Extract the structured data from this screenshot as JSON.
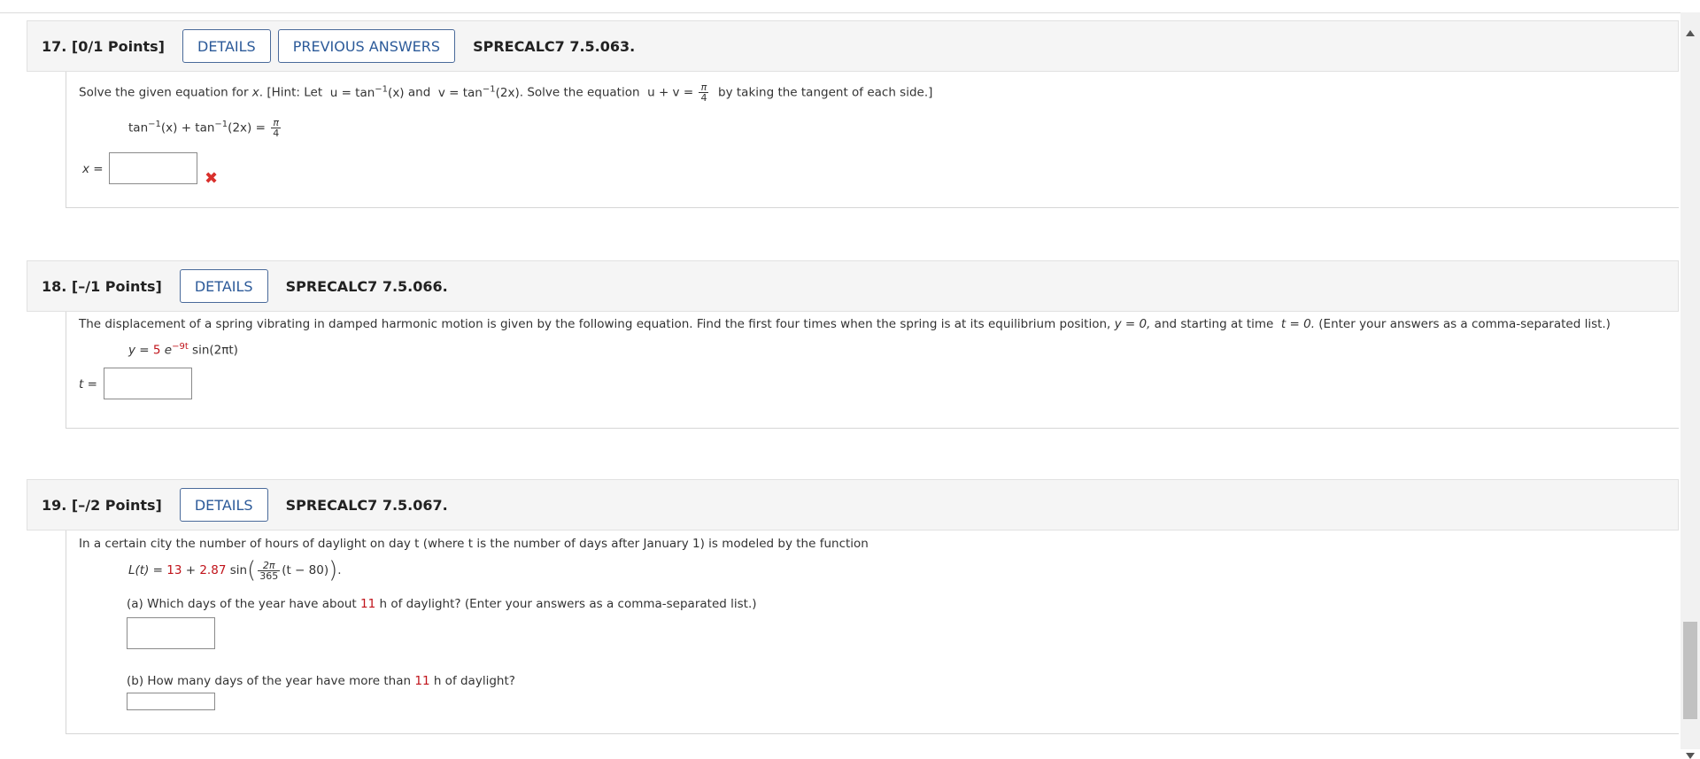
{
  "questions": [
    {
      "number": "17.",
      "points": "[0/1 Points]",
      "details_label": "DETAILS",
      "prev_label": "PREVIOUS ANSWERS",
      "code": "SPRECALC7 7.5.063.",
      "prompt_start": "Solve the given equation for ",
      "prompt_var": "x",
      "prompt_hint": ". [Hint: Let ",
      "hint_u": "u = tan",
      "hint_u_arg": "(x)",
      "hint_and": " and ",
      "hint_v": "v = tan",
      "hint_v_arg": "(2x)",
      "hint_solve": ". Solve the equation ",
      "hint_uv": "u + v = ",
      "hint_end": " by taking the tangent of each side.]",
      "equation_a": "tan",
      "equation_a_arg": "(x) + tan",
      "equation_b_arg": "(2x) = ",
      "pi": "π",
      "four": "4",
      "answer_label": "x =",
      "status_icon": "x-mark-icon"
    },
    {
      "number": "18.",
      "points": "[–/1 Points]",
      "details_label": "DETAILS",
      "code": "SPRECALC7 7.5.066.",
      "prompt": "The displacement of a spring vibrating in damped harmonic motion is given by the following equation. Find the first four times when the spring is at its equilibrium position, ",
      "prompt_eq": "y = 0,",
      "prompt_mid": " and starting at time ",
      "prompt_t": "t = 0.",
      "prompt_end": " (Enter your answers as a comma-separated list.)",
      "equation_lhs": "y = ",
      "equation_coef": "5",
      "equation_e": " e",
      "equation_exp": "−9t",
      "equation_rest": " sin(2πt)",
      "answer_label": "t ="
    },
    {
      "number": "19.",
      "points": "[–/2 Points]",
      "details_label": "DETAILS",
      "code": "SPRECALC7 7.5.067.",
      "prompt": "In a certain city the number of hours of daylight on day t (where t is the number of days after January 1) is modeled by the function",
      "eq_lhs": "L(t) = ",
      "eq_a": "13",
      "eq_plus": " + ",
      "eq_b": "2.87",
      "eq_sin": " sin",
      "eq_num": "2π",
      "eq_den": "365",
      "eq_tail": "(t − 80)",
      "eq_end": ".",
      "part_a_start": "(a) Which days of the year have about ",
      "part_a_num": "11",
      "part_a_end": " h of daylight? (Enter your answers as a comma-separated list.)",
      "part_b_start": "(b) How many days of the year have more than ",
      "part_b_num": "11",
      "part_b_end": " h of daylight?"
    }
  ],
  "colors": {
    "accent_button": "#2c5a99",
    "incorrect_mark": "#d9302c",
    "highlight_number": "#c0131a"
  }
}
